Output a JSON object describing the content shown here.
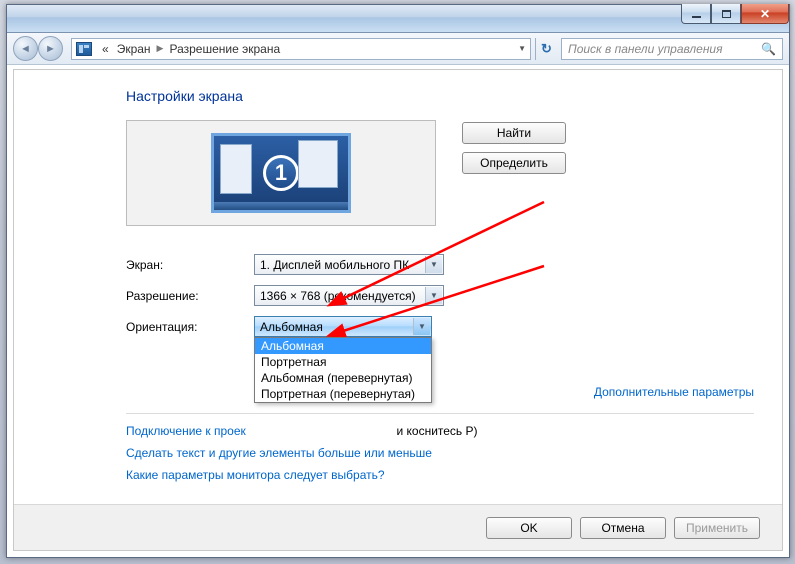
{
  "breadcrumb": {
    "prefix": "«",
    "part1": "Экран",
    "part2": "Разрешение экрана"
  },
  "search": {
    "placeholder": "Поиск в панели управления"
  },
  "heading": "Настройки экрана",
  "buttons": {
    "find": "Найти",
    "detect": "Определить",
    "ok": "OK",
    "cancel": "Отмена",
    "apply": "Применить"
  },
  "monitor_badge": "1",
  "labels": {
    "screen": "Экран:",
    "resolution": "Разрешение:",
    "orientation": "Ориентация:"
  },
  "values": {
    "screen": "1. Дисплей мобильного ПК",
    "resolution": "1366 × 768 (рекомендуется)",
    "orientation": "Альбомная"
  },
  "orientation_options": [
    "Альбомная",
    "Портретная",
    "Альбомная (перевернутая)",
    "Портретная (перевернутая)"
  ],
  "links": {
    "advanced": "Дополнительные параметры",
    "projector_prefix": "Подключение к проек",
    "projector_suffix": "и коснитесь P)",
    "text_size": "Сделать текст и другие элементы больше или меньше",
    "which_monitor": "Какие параметры монитора следует выбрать?"
  }
}
